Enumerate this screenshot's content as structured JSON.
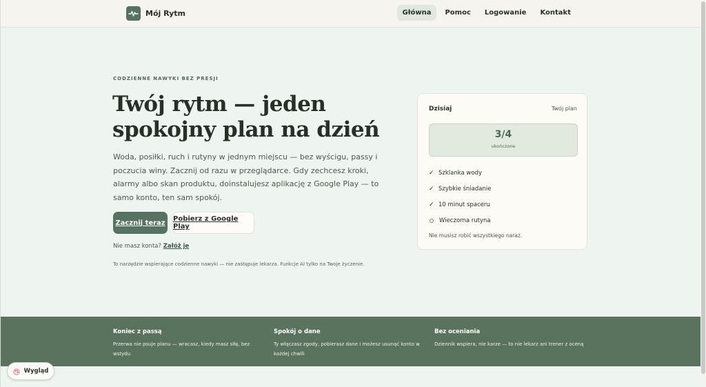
{
  "header": {
    "brand_name": "Mój Rytm",
    "nav": [
      {
        "label": "Główna",
        "active": true
      },
      {
        "label": "Pomoc",
        "active": false
      },
      {
        "label": "Logowanie",
        "active": false
      },
      {
        "label": "Kontakt",
        "active": false
      }
    ]
  },
  "hero": {
    "eyebrow": "CODZIENNE NAWYKI BEZ PRESJI",
    "title": "Twój rytm — jeden spokojny plan na dzień",
    "body": "Woda, posiłki, ruch i rutyny w jednym miejscu — bez wyścigu, passy i poczucia winy. Zacznij od razu w przeglądarce. Gdy zechcesz kroki, alarmy albo skan produktu, doinstalujesz aplikację z Google Play — to samo konto, ten sam spokój.",
    "primary_cta": "Zacznij teraz",
    "secondary_cta": "Pobierz z Google Play",
    "signup_prompt": "Nie masz konta?",
    "signup_link": "Załóż je",
    "disclaimer": "To narzędzie wspierające codzienne nawyki — nie zastępuje lekarza. Funkcje AI tylko na Twoje życzenie."
  },
  "today_card": {
    "title": "Dzisiaj",
    "subtitle": "Twój plan",
    "progress_value": "3/4",
    "progress_label": "ukończone",
    "tasks": [
      {
        "label": "Szklanka wody",
        "done": true
      },
      {
        "label": "Szybkie śniadanie",
        "done": true
      },
      {
        "label": "10 minut spaceru",
        "done": true
      },
      {
        "label": "Wieczorna rutyna",
        "done": false
      }
    ],
    "note": "Nie musisz robić wszystkiego naraz."
  },
  "values": [
    {
      "title": "Koniec z passą",
      "text": "Przerwa nie psuje planu — wracasz, kiedy masz siłę, bez wstydu"
    },
    {
      "title": "Spokój o dane",
      "text": "Ty włączasz zgody, pobierasz dane i możesz usunąć konto w każdej chwili"
    },
    {
      "title": "Bez oceniania",
      "text": "Dziennik wspiera, nie karze — to nie lekarz ani trener z oceną"
    }
  ],
  "appearance_toggle": {
    "label": "Wygląd",
    "icon": "palette-icon"
  },
  "colors": {
    "accent": "#567260",
    "band": "#5a735f",
    "background": "#eef4ef",
    "header": "#f6f4ee"
  }
}
